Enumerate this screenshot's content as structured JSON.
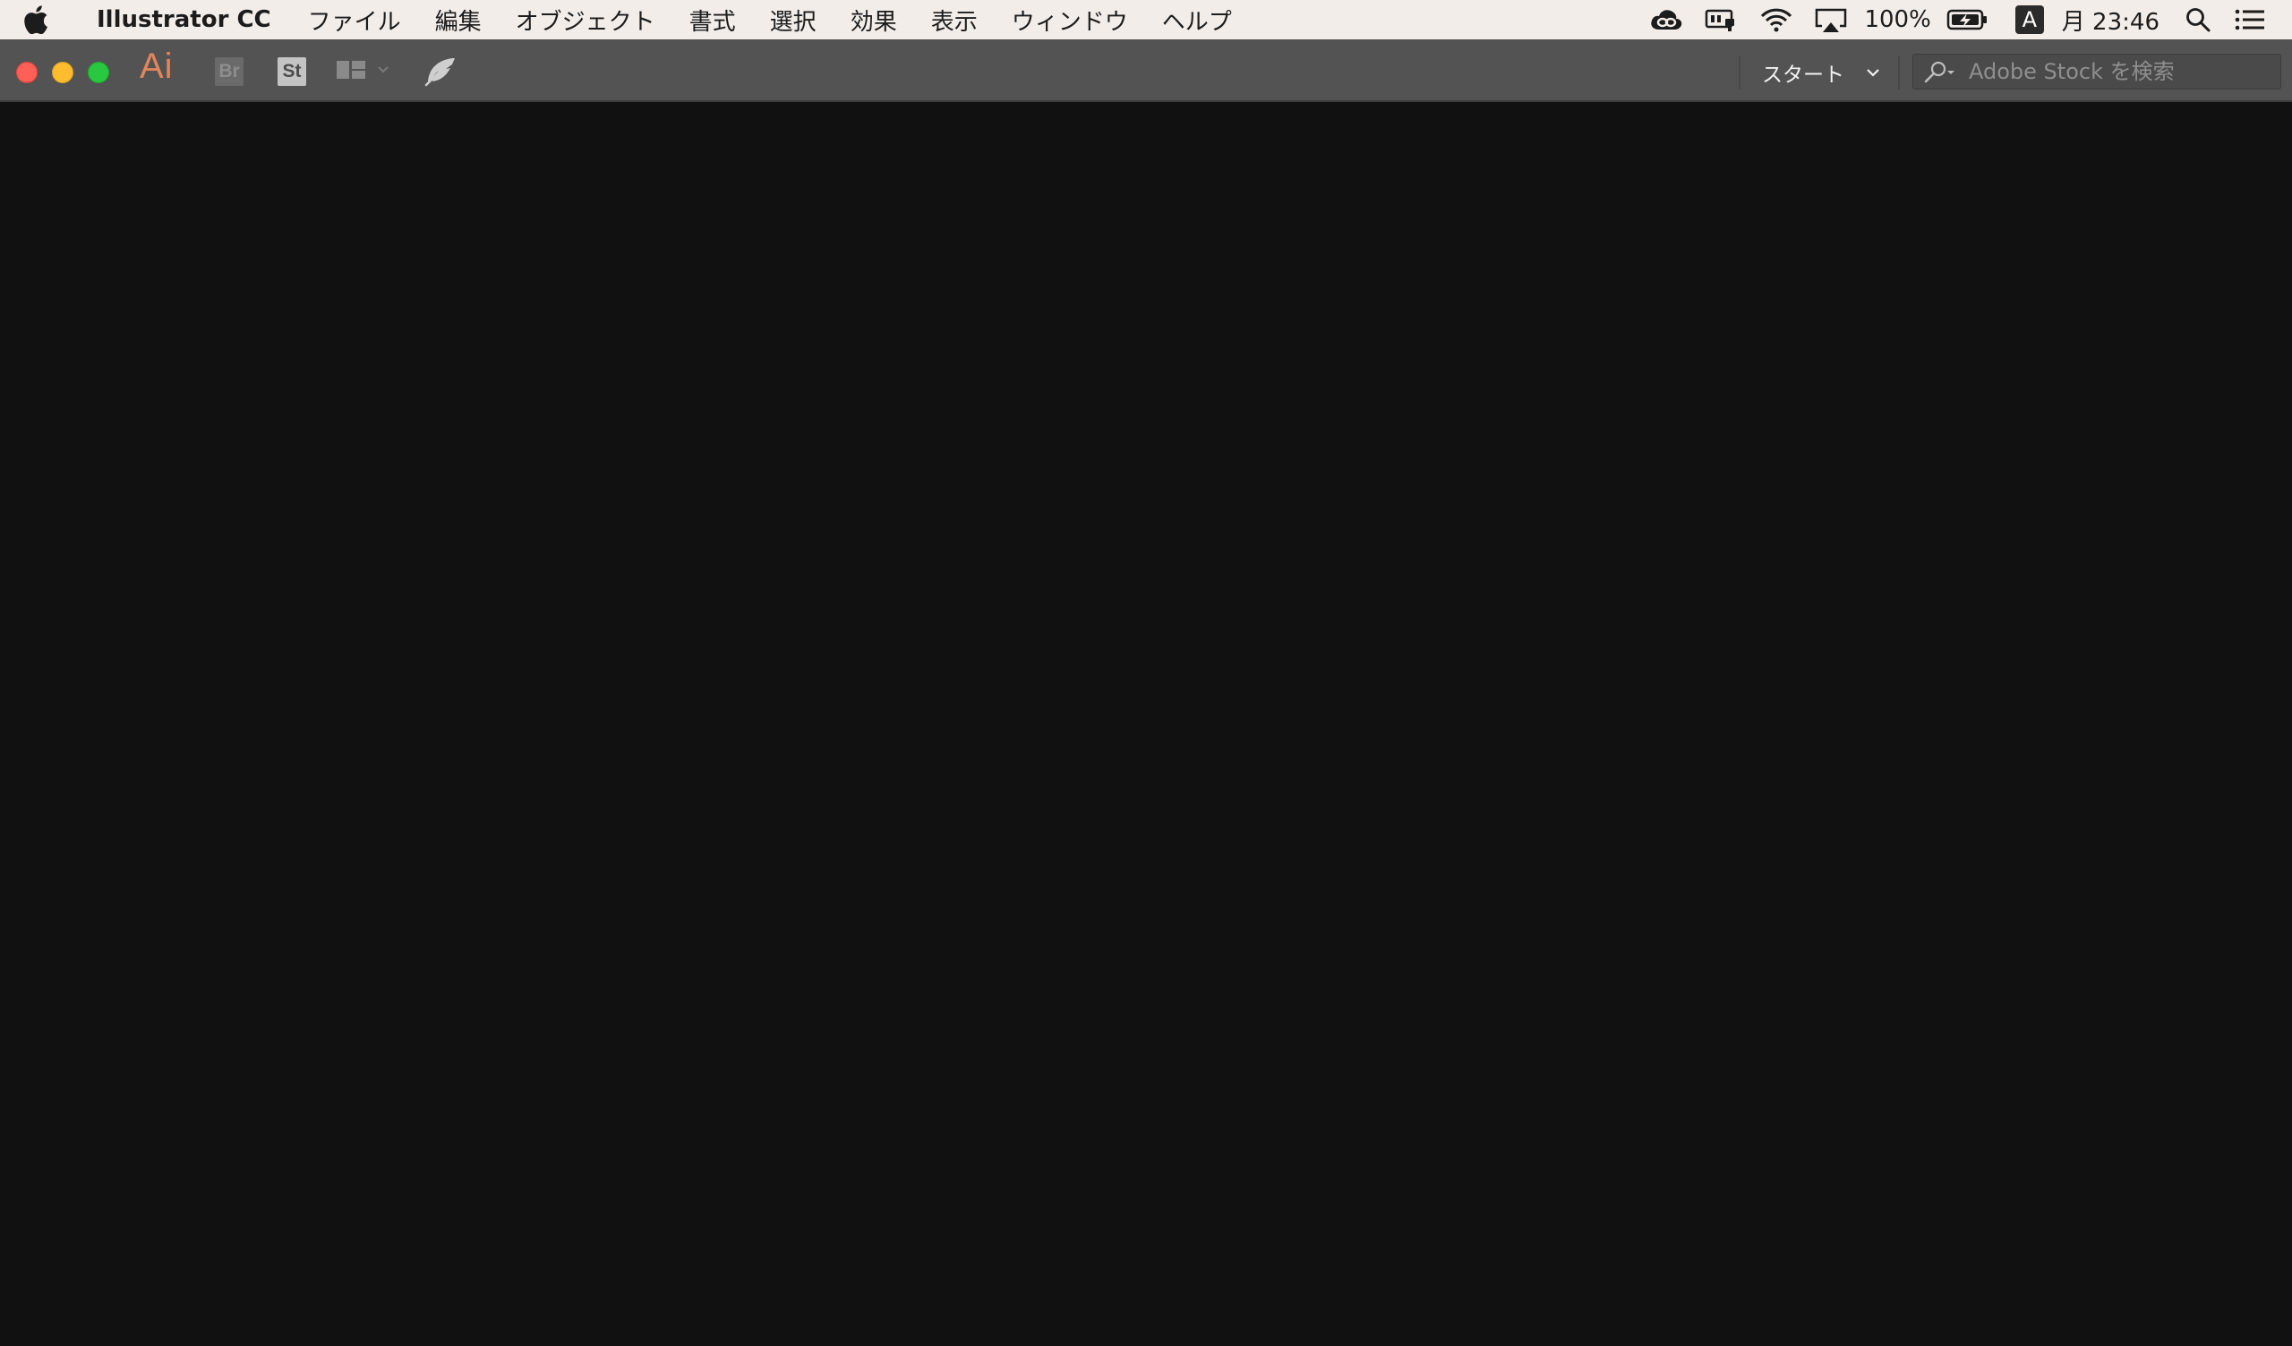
{
  "menubar": {
    "app_name": "Illustrator CC",
    "items": [
      {
        "label": "ファイル"
      },
      {
        "label": "編集"
      },
      {
        "label": "オブジェクト"
      },
      {
        "label": "書式"
      },
      {
        "label": "選択"
      },
      {
        "label": "効果"
      },
      {
        "label": "表示"
      },
      {
        "label": "ウィンドウ"
      },
      {
        "label": "ヘルプ"
      }
    ],
    "status": {
      "icons": [
        "creative-cloud-icon",
        "power-adapter-icon",
        "wifi-icon",
        "airplay-icon",
        "battery-charging-icon",
        "spotlight-search-icon",
        "notification-center-icon"
      ],
      "battery_percent": "100%",
      "input_source": "A",
      "clock": "月 23:46"
    }
  },
  "appbar": {
    "app_logo": "Ai",
    "bridge_badge": "Br",
    "stock_badge": "St",
    "workspace_label": "スタート",
    "stock_search_placeholder": "Adobe Stock を検索"
  },
  "colors": {
    "menubar_bg": "#f3ede9",
    "appbar_bg": "#535353",
    "canvas_bg": "#111111",
    "ai_logo": "#e1855c",
    "close": "#fe5f57",
    "minimize": "#febc2e",
    "maximize": "#28c840"
  }
}
